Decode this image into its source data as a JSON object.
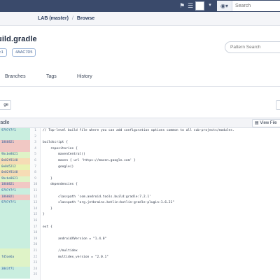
{
  "header": {
    "search_scope_icon": "globe-icon",
    "search_placeholder": "Search",
    "icons": [
      "bookmark-icon",
      "menu-icon",
      "avatar-box",
      "chevron-down-icon"
    ]
  },
  "breadcrumb": {
    "repo": "LAB (master)",
    "current": "Browse"
  },
  "file": {
    "title": "uild.gradle",
    "badges": [
      "c1",
      "4AAC7D5"
    ],
    "pattern_search_placeholder": "Pattern Search"
  },
  "tabs": [
    "Branches",
    "Tags",
    "History"
  ],
  "toolbar": {
    "left_button_label": "ge",
    "view_button_label": "View File"
  },
  "viewer": {
    "filename": "radle"
  },
  "colors": {
    "header_bg": "#3a4a6b",
    "blame_green": "#dff3c7",
    "blame_teal": "#c9eedf",
    "blame_red": "#f1c8c4",
    "blame_orange": "#f6dcb5",
    "blame_lime": "#e8f3b3"
  },
  "blame": [
    {
      "sha": "9797f7f1",
      "color": "#c9eedf"
    },
    {
      "sha": "",
      "color": "#c9eedf"
    },
    {
      "sha": "1860821",
      "color": "#f1c8c4"
    },
    {
      "sha": "",
      "color": "#f1c8c4"
    },
    {
      "sha": "9bcbe8621",
      "color": "#dff3c7"
    },
    {
      "sha": "0e02f8140",
      "color": "#f6dcb5"
    },
    {
      "sha": "0e0d5212",
      "color": "#e8f3b3"
    },
    {
      "sha": "0e02f8140",
      "color": "#f6dcb5"
    },
    {
      "sha": "9bcbe8621",
      "color": "#dff3c7"
    },
    {
      "sha": "1860821",
      "color": "#f1c8c4"
    },
    {
      "sha": "9797f7f1",
      "color": "#c9eedf"
    },
    {
      "sha": "1860821",
      "color": "#f1c8c4"
    },
    {
      "sha": "9797f7f1",
      "color": "#c9eedf"
    },
    {
      "sha": "",
      "color": "#c9eedf"
    },
    {
      "sha": "",
      "color": "#c9eedf"
    },
    {
      "sha": "",
      "color": "#c9eedf"
    },
    {
      "sha": "",
      "color": "#c9eedf"
    },
    {
      "sha": "",
      "color": "#c9eedf"
    },
    {
      "sha": "",
      "color": "#c9eedf"
    },
    {
      "sha": "",
      "color": "#c9eedf"
    },
    {
      "sha": "",
      "color": "#dff3c7"
    },
    {
      "sha": "fd5ae6a",
      "color": "#dff3c7"
    },
    {
      "sha": "",
      "color": "#dff3c7"
    },
    {
      "sha": "3843f71",
      "color": "#c9eedf"
    },
    {
      "sha": "",
      "color": "#c9eedf"
    }
  ],
  "lines": [
    {
      "n": "1",
      "text": "// Top-level build file where you can add configuration options common to all sub-projects/modules."
    },
    {
      "n": "2",
      "text": ""
    },
    {
      "n": "3",
      "text": "buildscript {"
    },
    {
      "n": "4",
      "text": "    repositories {"
    },
    {
      "n": "5",
      "text": "        mavenCentral()"
    },
    {
      "n": "6",
      "text": "        maven { url 'https://maven.google.com' }"
    },
    {
      "n": "7",
      "text": "        google()"
    },
    {
      "n": "8",
      "text": ""
    },
    {
      "n": "9",
      "text": "    }"
    },
    {
      "n": "10",
      "text": "    dependencies {"
    },
    {
      "n": "11",
      "text": ""
    },
    {
      "n": "12",
      "text": "        classpath 'com.android.tools.build:gradle:7.2.1'"
    },
    {
      "n": "13",
      "text": "        classpath \"org.jetbrains.kotlin:kotlin-gradle-plugin:1.6.21\""
    },
    {
      "n": "14",
      "text": "    }"
    },
    {
      "n": "15",
      "text": "}"
    },
    {
      "n": "16",
      "text": ""
    },
    {
      "n": "17",
      "text": "ext {"
    },
    {
      "n": "18",
      "text": ""
    },
    {
      "n": "19",
      "text": "        androidXVersion = \"1.4.0\""
    },
    {
      "n": "20",
      "text": ""
    },
    {
      "n": "21",
      "text": "        //multidex"
    },
    {
      "n": "22",
      "text": "        multidex_version = \"2.0.1\""
    },
    {
      "n": "23",
      "text": ""
    },
    {
      "n": "24",
      "text": ""
    },
    {
      "n": "25",
      "text": ""
    }
  ]
}
